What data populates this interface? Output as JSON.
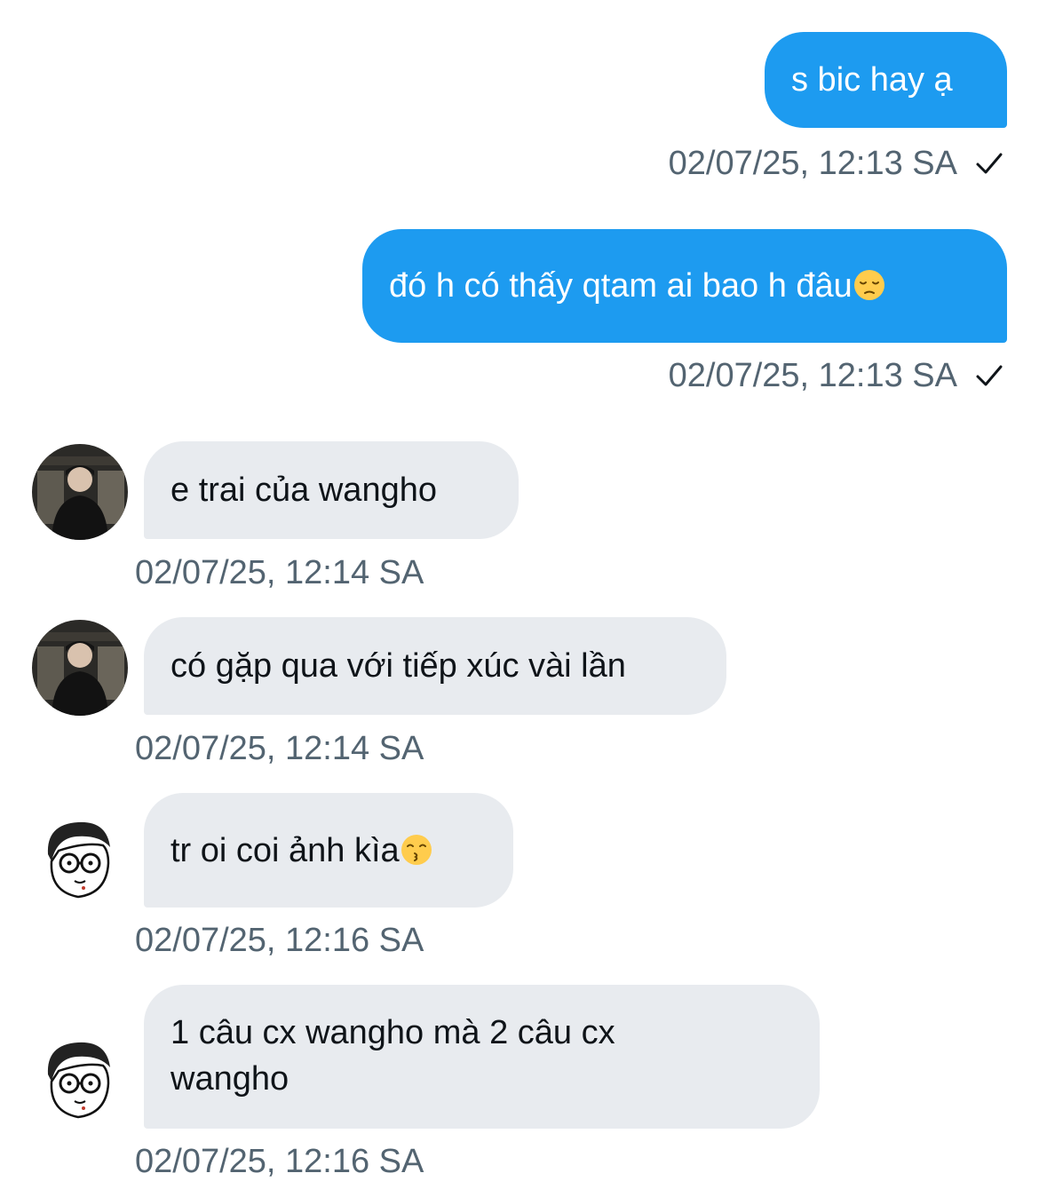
{
  "messages": [
    {
      "direction": "outgoing",
      "text": "s bic hay ạ",
      "timestamp": "02/07/25, 12:13 SA",
      "seen_icon": "checkmark-icon"
    },
    {
      "direction": "outgoing",
      "text": "đó h có thấy qtam ai bao h đâu",
      "emoji": "pensive-face-emoji",
      "timestamp": "02/07/25, 12:13 SA",
      "seen_icon": "checkmark-icon"
    },
    {
      "direction": "incoming",
      "avatar": "dark-photo-avatar",
      "text": "e trai của wangho",
      "timestamp": "02/07/25, 12:14 SA"
    },
    {
      "direction": "incoming",
      "avatar": "dark-photo-avatar",
      "text": "có gặp qua với tiếp xúc vài lần",
      "timestamp": "02/07/25, 12:14 SA"
    },
    {
      "direction": "incoming",
      "avatar": "cartoon-glasses-avatar",
      "text": "tr oi coi ảnh kìa",
      "emoji": "kissing-face-emoji",
      "timestamp": "02/07/25, 12:16 SA"
    },
    {
      "direction": "incoming",
      "avatar": "cartoon-glasses-avatar",
      "text": "1 câu cx wangho mà 2 câu cx wangho",
      "timestamp": "02/07/25, 12:16 SA"
    }
  ],
  "colors": {
    "outgoing_bubble": "#1d9bf0",
    "incoming_bubble": "#e8ebef",
    "timestamp_text": "#536471"
  }
}
